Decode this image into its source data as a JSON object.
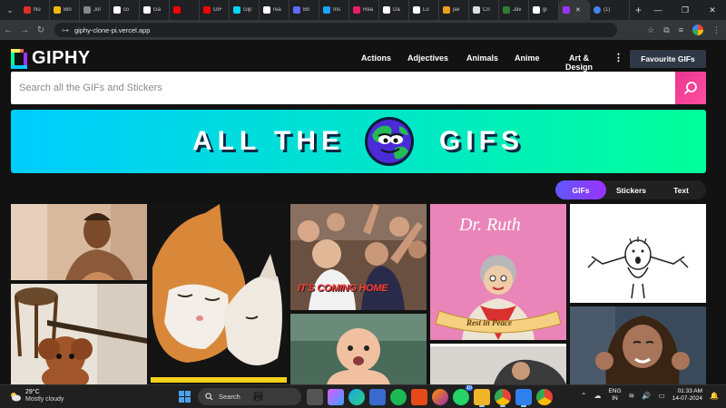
{
  "browser": {
    "tabs": [
      {
        "label": "Nu",
        "color": "#d93025"
      },
      {
        "label": "Bin",
        "color": "#f0b90b"
      },
      {
        "label": "Jol",
        "color": "#888888"
      },
      {
        "label": "co",
        "color": "#ffffff"
      },
      {
        "label": "Ga",
        "color": "#ffffff"
      },
      {
        "label": "",
        "color": "#ff0000"
      },
      {
        "label": "GIF",
        "color": "#ff0000"
      },
      {
        "label": "Gip",
        "color": "#00d4ff"
      },
      {
        "label": "rea",
        "color": "#ffffff"
      },
      {
        "label": "Bri",
        "color": "#5b6bff"
      },
      {
        "label": "Ins",
        "color": "#1aa3ff"
      },
      {
        "label": "Rea",
        "color": "#e91e63"
      },
      {
        "label": "Da",
        "color": "#ffffff"
      },
      {
        "label": "Lo",
        "color": "#ffffff"
      },
      {
        "label": "jav",
        "color": "#f0a020"
      },
      {
        "label": "Cri",
        "color": "#dddddd"
      },
      {
        "label": "Jav",
        "color": "#2e7d32"
      },
      {
        "label": "gi",
        "color": "#ffffff"
      }
    ],
    "active_tab": {
      "label": "",
      "color": "#9933ff"
    },
    "last_tab": {
      "label": "(1)",
      "color": "#4285f4"
    },
    "url": "giphy-clone-pi.vercel.app"
  },
  "header": {
    "logo_text": "GIPHY",
    "nav": [
      "Actions",
      "Adjectives",
      "Animals",
      "Anime",
      "Art & Design"
    ],
    "more_label": "⋮",
    "favourite_label": "Favourite GIFs"
  },
  "search": {
    "placeholder": "Search all the GIFs and Stickers"
  },
  "banner": {
    "left_text": "ALL THE",
    "right_text": "GIFS"
  },
  "filter": {
    "options": [
      "GIFs",
      "Stickers",
      "Text"
    ],
    "selected": "GIFs"
  },
  "gifs": {
    "coming_home_caption": "IT'S COMING HOME",
    "dr_ruth_title": "Dr. Ruth",
    "dr_ruth_banner": "Rest in Peace"
  },
  "taskbar": {
    "temperature": "29°C",
    "condition": "Mostly cloudy",
    "search_label": "Search",
    "whatsapp_badge": "10",
    "lang_top": "ENG",
    "lang_bottom": "IN",
    "time": "01:33 AM",
    "date": "14-07-2024"
  }
}
